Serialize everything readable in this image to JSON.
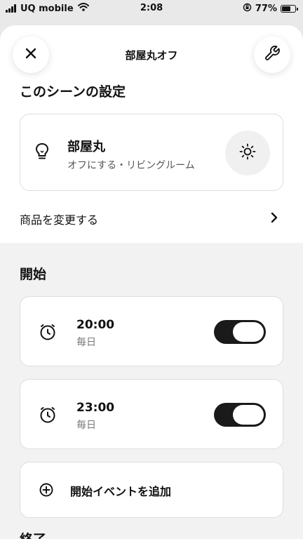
{
  "status_bar": {
    "carrier": "UQ mobile",
    "time": "2:08",
    "battery_percent": "77%",
    "battery_level": 0.77
  },
  "header": {
    "title": "部屋丸オフ",
    "close_icon": "close-icon",
    "settings_icon": "wrench-icon"
  },
  "scene_settings": {
    "title": "このシーンの設定",
    "product": {
      "name": "部屋丸",
      "subtitle": "オフにする・リビングルーム",
      "icon": "bulb-icon",
      "action_icon": "brightness-icon"
    },
    "change_product_label": "商品を変更する"
  },
  "start": {
    "title": "開始",
    "events": [
      {
        "time": "20:00",
        "repeat": "毎日",
        "enabled": true
      },
      {
        "time": "23:00",
        "repeat": "毎日",
        "enabled": true
      }
    ],
    "add_event_label": "開始イベントを追加"
  },
  "end": {
    "title": "終了"
  },
  "colors": {
    "toggle_on": "#1a1a1a",
    "sheet_background": "#f2f2f2",
    "card_background": "#ffffff"
  }
}
